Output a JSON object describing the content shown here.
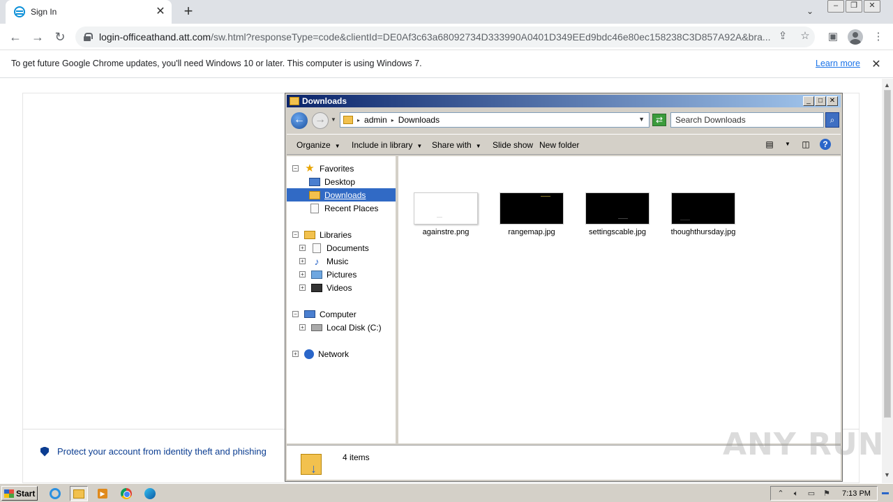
{
  "browser": {
    "tab": {
      "title": "Sign In"
    },
    "url": {
      "host": "login-officeathand.att.com",
      "rest": "/sw.html?responseType=code&clientId=DE0Af3c63a68092734D333990A0401D349EEd9bdc46e80ec158238C3D857A92A&bra..."
    },
    "infobar": {
      "message": "To get future Google Chrome updates, you'll need Windows 10 or later. This computer is using Windows 7.",
      "learn_more": "Learn more"
    }
  },
  "page": {
    "protect_text": "Protect your account from identity theft and phishing"
  },
  "explorer": {
    "title": "Downloads",
    "breadcrumb": [
      "admin",
      "Downloads"
    ],
    "search_placeholder": "Search Downloads",
    "toolbar": {
      "organize": "Organize",
      "include_in_library": "Include in library",
      "share_with": "Share with",
      "slide_show": "Slide show",
      "new_folder": "New folder"
    },
    "nav": {
      "favorites": "Favorites",
      "desktop": "Desktop",
      "downloads": "Downloads",
      "recent_places": "Recent Places",
      "libraries": "Libraries",
      "documents": "Documents",
      "music": "Music",
      "pictures": "Pictures",
      "videos": "Videos",
      "computer": "Computer",
      "local_disk": "Local Disk (C:)",
      "network": "Network"
    },
    "files": [
      {
        "name": "againstre.png"
      },
      {
        "name": "rangemap.jpg"
      },
      {
        "name": "settingscable.jpg"
      },
      {
        "name": "thoughthursday.jpg"
      }
    ],
    "status": "4 items"
  },
  "watermark": "ANY RUN",
  "taskbar": {
    "start": "Start",
    "clock": "7:13 PM"
  },
  "colors": {
    "selection": "#316ac5",
    "titlebar_start": "#0a246a",
    "link": "#1a73e8",
    "protect": "#0b3d91"
  }
}
